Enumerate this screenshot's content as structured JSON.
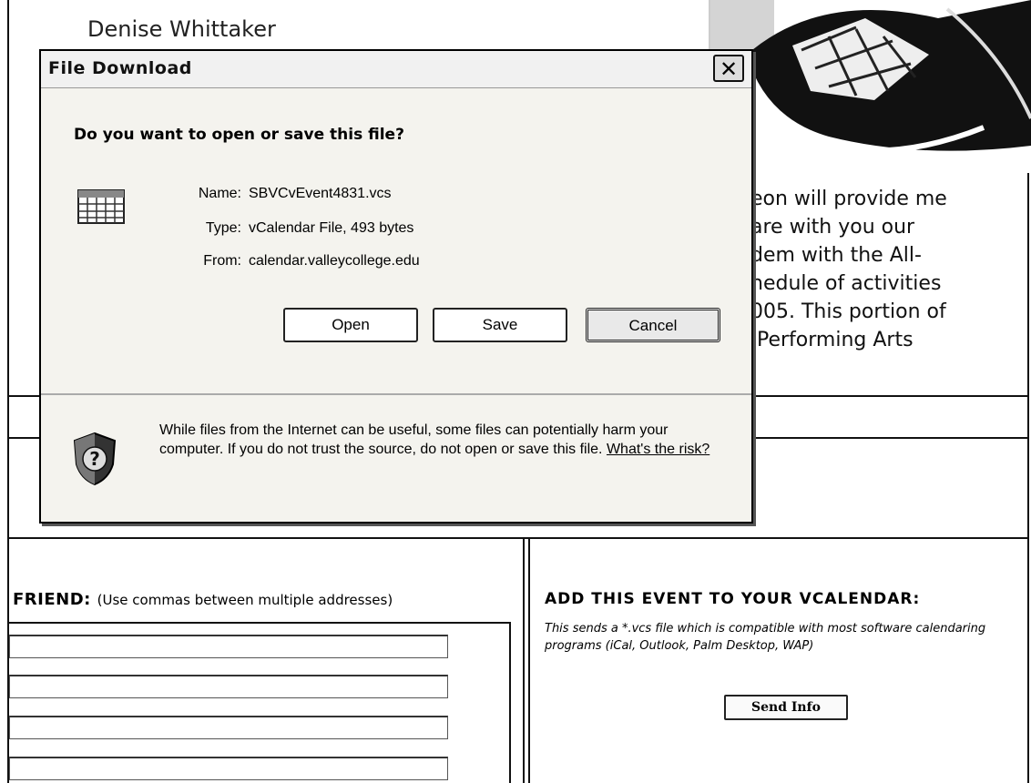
{
  "background_page": {
    "person_name": "Denise Whittaker",
    "article_lines": [
      "eon will provide me",
      "are with you our",
      "dem with the All-",
      "hedule of activities",
      "005. This portion of",
      " Performing Arts"
    ],
    "friend_heading": "FRIEND:",
    "friend_hint": "(Use commas between multiple addresses)",
    "vcal_heading": "ADD THIS EVENT TO YOUR VCALENDAR:",
    "vcal_description": "This sends a *.vcs file which is compatible with most software calendaring programs (iCal, Outlook, Palm Desktop, WAP)",
    "send_button": "Send Info"
  },
  "dialog": {
    "title": "File Download",
    "close_glyph": "✕",
    "question": "Do you want to open or save this file?",
    "name_label": "Name:",
    "name_value": "SBVCvEvent4831.vcs",
    "type_label": "Type:",
    "type_value": "vCalendar File, 493 bytes",
    "from_label": "From:",
    "from_value": "calendar.valleycollege.edu",
    "open_button": "Open",
    "save_button": "Save",
    "cancel_button": "Cancel",
    "warning_text": "While files from the Internet can be useful, some files can potentially harm your computer. If you do not trust the source, do not open or save this file.",
    "risk_link": "What's the risk?",
    "icons": {
      "file": "calendar-file-icon",
      "warning": "security-shield-icon"
    }
  }
}
